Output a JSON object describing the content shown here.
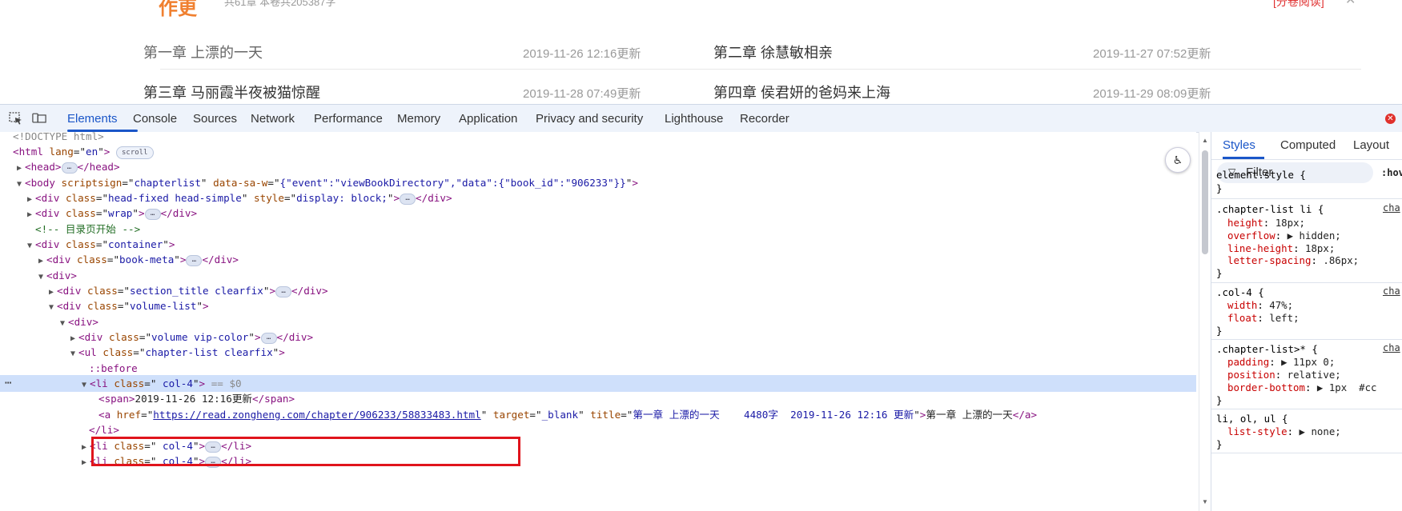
{
  "page": {
    "top_title_fragment": "作更",
    "top_meta_fragment": "共61章 本卷共205387字",
    "top_right_link": "[分卷阅读]",
    "chapters": [
      {
        "title": "第一章 上漂的一天",
        "time": "2019-11-26 12:16更新"
      },
      {
        "title": "第二章 徐慧敏相亲",
        "time": "2019-11-27 07:52更新"
      },
      {
        "title": "第三章 马丽霞半夜被猫惊醒",
        "time": "2019-11-28 07:49更新"
      },
      {
        "title": "第四章 侯君妍的爸妈来上海",
        "time": "2019-11-29 08:09更新"
      }
    ]
  },
  "devtools": {
    "tabs": [
      "Elements",
      "Console",
      "Sources",
      "Network",
      "Performance",
      "Memory",
      "Application",
      "Privacy and security",
      "Lighthouse",
      "Recorder"
    ],
    "active_tab": "Elements",
    "error_badge": "✕",
    "dom": {
      "doctype": "<!DOCTYPE html>",
      "html_open": "<html",
      "html_lang_name": "lang",
      "html_lang_val": "en",
      "scroll_badge": "scroll",
      "head": "<head>",
      "head_close": "</head>",
      "body_open": "<body",
      "body_attr1_name": "scriptsign",
      "body_attr1_val": "chapterlist",
      "body_attr2_name": "data-sa-w",
      "body_attr2_val": "{\"event\":\"viewBookDirectory\",\"data\":{\"book_id\":\"906233\"}}",
      "div_head_class": "head-fixed head-simple",
      "div_head_style": "display: block;",
      "div_wrap_class": "wrap",
      "comment": "<!-- 目录页开始 -->",
      "div_container_class": "container",
      "div_bookmeta_class": "book-meta",
      "div_plain": "<div>",
      "div_section_class": "section_title clearfix",
      "div_volumelist_class": "volume-list",
      "div_volume_class": "volume vip-color",
      "ul_class": "chapter-list clearfix",
      "before": "::before",
      "li_class": " col-4",
      "selected_marker": "== $0",
      "span_text": "2019-11-26 12:16更新",
      "a_href": "https://read.zongheng.com/chapter/906233/58833483.html",
      "a_target": "_blank",
      "a_title": "第一章 上漂的一天    4480字  2019-11-26 12:16 更新",
      "a_text": "第一章 上漂的一天",
      "li_close": "</li>"
    },
    "styles_pane": {
      "tabs": [
        "Styles",
        "Computed",
        "Layout"
      ],
      "filter_placeholder": "Filter",
      "hov": ":hov",
      "rules": [
        {
          "selector": "element.style {",
          "props": [],
          "source": ""
        },
        {
          "selector": ".chapter-list li {",
          "source": "cha",
          "props": [
            {
              "name": "height",
              "value": "18px;"
            },
            {
              "name": "overflow",
              "value": "▶ hidden;"
            },
            {
              "name": "line-height",
              "value": "18px;"
            },
            {
              "name": "letter-spacing",
              "value": ".86px;"
            }
          ]
        },
        {
          "selector": ".col-4 {",
          "source": "cha",
          "props": [
            {
              "name": "width",
              "value": "47%;"
            },
            {
              "name": "float",
              "value": "left;"
            }
          ]
        },
        {
          "selector": ".chapter-list>* {",
          "source": "cha",
          "props": [
            {
              "name": "padding",
              "value": "▶ 11px 0;"
            },
            {
              "name": "position",
              "value": "relative;"
            },
            {
              "name": "border-bottom",
              "value": "▶ 1px  #cc"
            }
          ]
        },
        {
          "selector": "li, ol, ul {",
          "source": "",
          "props": [
            {
              "name": "list-style",
              "value": "▶ none;"
            }
          ]
        }
      ]
    }
  }
}
